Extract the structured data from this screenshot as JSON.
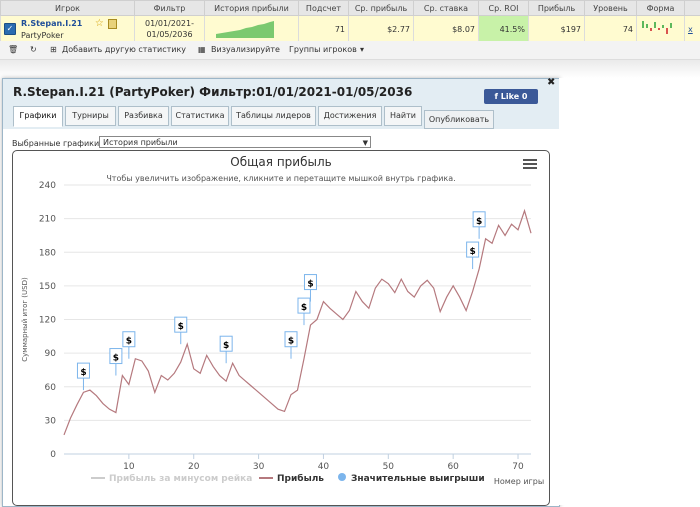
{
  "table": {
    "headers": [
      "Игрок",
      "Фильтр",
      "История прибыли",
      "Подсчет",
      "Ср. прибыль",
      "Ср. ставка",
      "Ср. ROI",
      "Прибыль",
      "Уровень",
      "Форма"
    ],
    "row": {
      "player": "R.Stepan.I.21",
      "site": "PartyPoker",
      "filter_line1": "01/01/2021-",
      "filter_line2": "01/05/2036",
      "count": "71",
      "avg_profit": "$2.77",
      "avg_stake": "$8.07",
      "avg_roi": "41.5%",
      "profit": "$197",
      "level": "74",
      "remove": "x"
    }
  },
  "toolbar": {
    "add_stats": "Добавить другую статистику",
    "visualize": "Визуализируйте",
    "groups": "Группы игроков"
  },
  "dialog": {
    "title": "R.Stepan.I.21 (PartyPoker) Фильтр:01/01/2021-01/05/2036",
    "like": "Like 0",
    "close": "✖",
    "tabs": [
      "Графики",
      "Турниры",
      "Разбивка",
      "Статистика",
      "Таблицы лидеров",
      "Достижения",
      "Найти"
    ],
    "publish": "Опубликовать",
    "select_label": "Выбранные графики:",
    "select_value": "История прибыли"
  },
  "chart_data": {
    "type": "line",
    "title": "Общая прибыль",
    "subtitle": "Чтобы увеличить изображение, кликните и перетащите мышкой внутрь графика.",
    "xlabel": "Номер игры",
    "ylabel": "Суммарный итог (USD)",
    "ylim": [
      0,
      240
    ],
    "xlim": [
      0,
      72
    ],
    "yticks": [
      0,
      30,
      60,
      90,
      120,
      150,
      180,
      210,
      240
    ],
    "xticks": [
      10,
      20,
      30,
      40,
      50,
      60,
      70
    ],
    "grid": true,
    "legend_position": "bottom",
    "series": [
      {
        "name": "Прибыль за минусом рейка",
        "color": "#cccccc",
        "values": []
      },
      {
        "name": "Прибыль",
        "color": "#b5797e",
        "values": [
          17,
          32,
          44,
          55,
          57,
          52,
          45,
          40,
          37,
          70,
          62,
          85,
          83,
          74,
          55,
          70,
          66,
          72,
          82,
          98,
          76,
          72,
          88,
          78,
          70,
          65,
          81,
          70,
          65,
          60,
          55,
          50,
          45,
          40,
          38,
          53,
          57,
          85,
          115,
          120,
          136,
          130,
          125,
          120,
          128,
          145,
          136,
          130,
          148,
          156,
          152,
          144,
          156,
          145,
          140,
          150,
          155,
          148,
          127,
          140,
          150,
          140,
          128,
          145,
          165,
          192,
          188,
          204,
          195,
          205,
          200,
          217,
          197
        ]
      },
      {
        "name": "Значительные выигрыши",
        "color": "#7cb5ec",
        "type": "flag"
      }
    ],
    "flags": [
      {
        "x": 3,
        "y": 57,
        "label": "$"
      },
      {
        "x": 8,
        "y": 70,
        "label": "$"
      },
      {
        "x": 10,
        "y": 85,
        "label": "$"
      },
      {
        "x": 18,
        "y": 98,
        "label": "$"
      },
      {
        "x": 25,
        "y": 81,
        "label": "$"
      },
      {
        "x": 35,
        "y": 85,
        "label": "$"
      },
      {
        "x": 37,
        "y": 115,
        "label": "$"
      },
      {
        "x": 38,
        "y": 136,
        "label": "$"
      },
      {
        "x": 63,
        "y": 165,
        "label": "$"
      },
      {
        "x": 64,
        "y": 192,
        "label": "$"
      }
    ]
  },
  "icons": [
    "checkbox-icon",
    "star-icon",
    "money-bag-icon",
    "trash-icon",
    "refresh-icon",
    "add-stats-icon",
    "chart-icon",
    "dropdown-arrow-icon",
    "facebook-icon",
    "menu-icon"
  ]
}
